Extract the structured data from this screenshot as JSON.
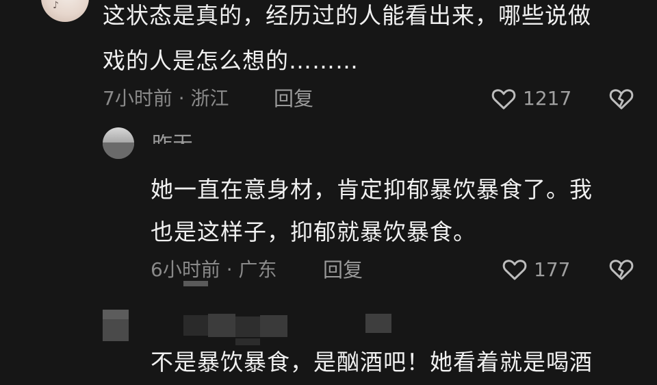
{
  "comments": [
    {
      "text_line1": "这状态是真的，经历过的人能看出来，哪些说做",
      "text_line2": "戏的人是怎么想的………",
      "meta": "7小时前 · 浙江",
      "reply_label": "回复",
      "likes": "1217",
      "avatar_mark": "♪"
    },
    {
      "author_partial": "昨天",
      "text_line1": "她一直在意身材，肯定抑郁暴饮暴食了。我",
      "text_line2": "也是这样子，抑郁就暴饮暴食。",
      "meta": "6小时前 · 广东",
      "reply_label": "回复",
      "likes": "177"
    },
    {
      "text_line1": "不是暴饮暴食，是酗酒吧！她看着就是喝酒"
    }
  ],
  "icons": {
    "like": "heart-outline-icon",
    "dislike": "broken-heart-icon"
  },
  "colors": {
    "background": "#161616",
    "text": "#f0f0f0",
    "meta": "#8a8a8a"
  }
}
